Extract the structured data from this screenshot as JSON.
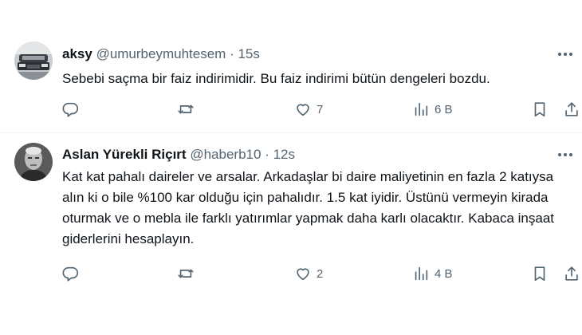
{
  "tweets": [
    {
      "name": "aksy",
      "handle": "@umurbeymuhtesem",
      "separator": "·",
      "time": "15s",
      "text": "Sebebi saçma bir faiz indirimidir. Bu faiz indirimi bütün dengeleri bozdu.",
      "replies": "",
      "retweets": "",
      "likes": "7",
      "views": "6 B"
    },
    {
      "name": "Aslan Yürekli Riçırt",
      "handle": "@haberb10",
      "separator": "·",
      "time": "12s",
      "text": "Kat kat pahalı daireler ve arsalar. Arkadaşlar bi daire maliyetinin en fazla 2 katıysa alın ki o bile %100 kar olduğu için pahalıdır. 1.5 kat iyidir. Üstünü vermeyin kirada oturmak ve o mebla ile farklı yatırımlar yapmak daha karlı olacaktır. Kabaca inşaat giderlerini hesaplayın.",
      "replies": "",
      "retweets": "",
      "likes": "2",
      "views": "4 B"
    }
  ],
  "icons": {
    "reply": "reply-icon",
    "retweet": "retweet-icon",
    "like": "heart-icon",
    "views": "views-icon",
    "bookmark": "bookmark-icon",
    "share": "share-icon",
    "more": "more-icon"
  },
  "colors": {
    "text": "#0f1419",
    "secondary": "#536471",
    "divider": "#eff3f4"
  }
}
